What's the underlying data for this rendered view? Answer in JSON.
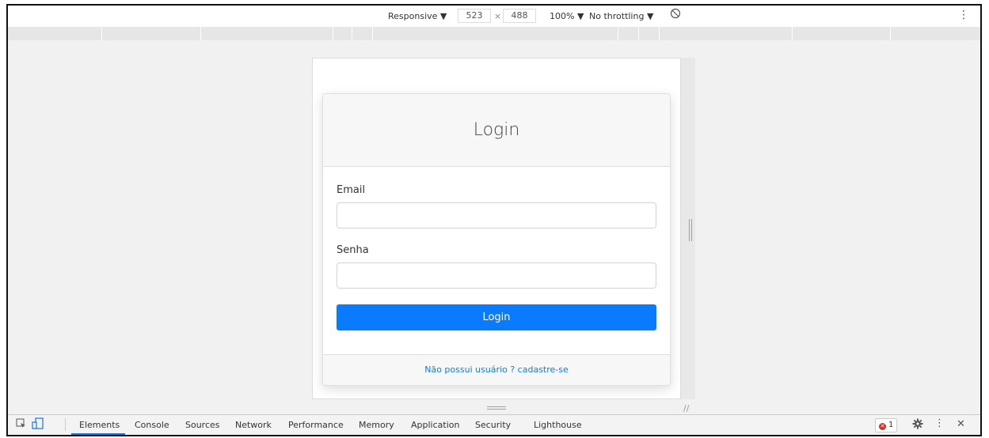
{
  "toolbar": {
    "device": "Responsive ▼",
    "width": "523",
    "times": "×",
    "height": "488",
    "zoom": "100% ▼",
    "throttling": "No throttling ▼",
    "rotate_icon": "rotate-icon",
    "menu": "⋮"
  },
  "login": {
    "title": "Login",
    "email_label": "Email",
    "email_value": "",
    "password_label": "Senha",
    "password_value": "",
    "submit_label": "Login",
    "footer_link": "Não possui usuário ? cadastre-se",
    "accent": "#0a7bff"
  },
  "devtools": {
    "tabs": [
      "Elements",
      "Console",
      "Sources",
      "Network",
      "Performance",
      "Memory",
      "Application",
      "Security",
      "Lighthouse"
    ],
    "active_tab": "Elements",
    "error_count": "1",
    "error_glyph": "✕",
    "more": "⋮",
    "close": "✕",
    "error_color": "#d93025",
    "active_color": "#1a73e8"
  }
}
